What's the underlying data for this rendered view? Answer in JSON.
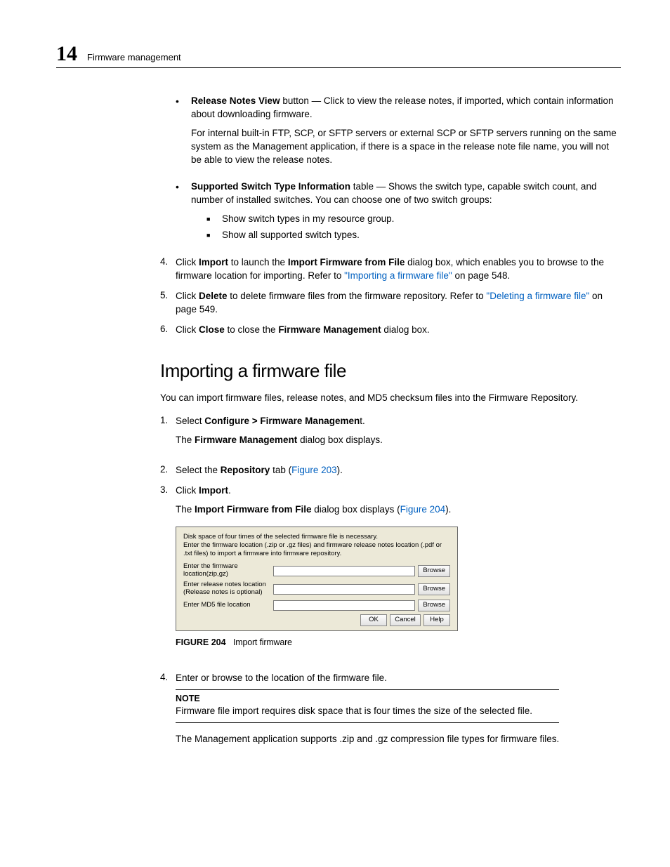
{
  "header": {
    "chapter_number": "14",
    "chapter_title": "Firmware management"
  },
  "bullet1": {
    "lead_bold": "Release Notes View",
    "lead_rest": " button — Click to view the release notes, if imported, which contain information about downloading firmware.",
    "para2": "For internal built-in FTP, SCP, or SFTP servers or external SCP or SFTP servers running on the same system as the Management application, if there is a space in the release note file name, you will not be able to view the release notes."
  },
  "bullet2": {
    "lead_bold": "Supported Switch Type Information",
    "lead_rest": " table — Shows the switch type, capable switch count, and number of installed switches. You can choose one of two switch groups:",
    "sub_a": "Show switch types in my resource group.",
    "sub_b": "Show all supported switch types."
  },
  "num4": {
    "n": "4.",
    "pre": "Click ",
    "b1": "Import",
    "mid": " to launch the ",
    "b2": "Import Firmware from File",
    "post1": " dialog box, which enables you to browse to the firmware location for importing. Refer to ",
    "link": "\"Importing a firmware file\"",
    "post2": " on page 548."
  },
  "num5": {
    "n": "5.",
    "pre": "Click ",
    "b1": "Delete",
    "mid": " to delete firmware files from the firmware repository. Refer to ",
    "link": "\"Deleting a firmware file\"",
    "post": " on page 549."
  },
  "num6": {
    "n": "6.",
    "pre": "Click ",
    "b1": "Close",
    "mid": " to close the ",
    "b2": "Firmware Management",
    "post": " dialog box."
  },
  "section_heading": "Importing a firmware file",
  "section_intro": "You can import firmware files, release notes, and MD5 checksum files into the Firmware Repository.",
  "s1": {
    "n": "1.",
    "pre": "Select ",
    "b1": "Configure > Firmware Managemen",
    "post": "t.",
    "sub_pre": "The ",
    "sub_b": "Firmware Management",
    "sub_post": " dialog box displays."
  },
  "s2": {
    "n": "2.",
    "pre": "Select the ",
    "b1": "Repository",
    "mid": " tab (",
    "link": "Figure 203",
    "post": ")."
  },
  "s3": {
    "n": "3.",
    "pre": "Click ",
    "b1": "Import",
    "post": ".",
    "sub_pre": "The ",
    "sub_b": "Import Firmware from File",
    "sub_mid": " dialog box displays (",
    "sub_link": "Figure 204",
    "sub_post": ")."
  },
  "dialog": {
    "intro_l1": "Disk space of four times of the selected firmware file is necessary.",
    "intro_l2": "Enter the firmware location (.zip or .gz files) and firmware release notes location (.pdf or .txt files) to import a firmware into firmware repository.",
    "row1_label": "Enter the firmware location(zip,gz)",
    "row2_label_a": "Enter release notes location",
    "row2_label_b": "(Release notes is optional)",
    "row3_label": "Enter MD5 file location",
    "browse": "Browse",
    "ok": "OK",
    "cancel": "Cancel",
    "help": "Help"
  },
  "figcaption": {
    "bold": "FIGURE 204",
    "title": "Import firmware"
  },
  "s4": {
    "n": "4.",
    "text": "Enter or browse to the location of the firmware file."
  },
  "note": {
    "title": "NOTE",
    "body": "Firmware file import requires disk space that is four times the size of the selected file."
  },
  "trailing": "The Management application supports .zip and .gz compression file types for firmware files."
}
